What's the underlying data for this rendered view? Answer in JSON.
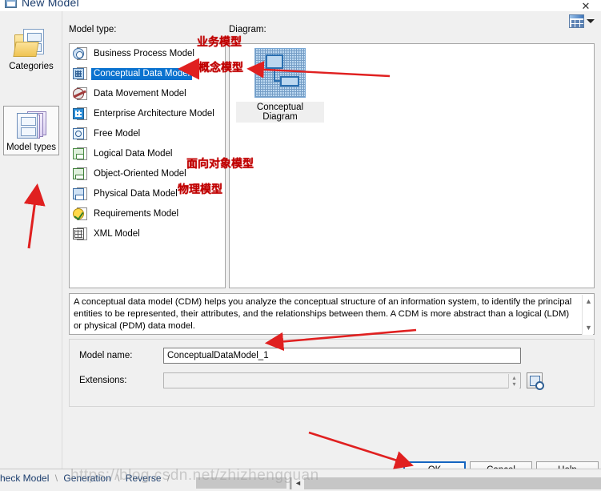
{
  "window": {
    "title": "New Model",
    "close_label": "✕"
  },
  "sidebar": {
    "items": [
      {
        "label": "Categories",
        "icon": "folder-documents-icon",
        "selected": false
      },
      {
        "label": "Model types",
        "icon": "layered-pages-icon",
        "selected": true
      }
    ]
  },
  "labels": {
    "model_type": "Model type:",
    "diagram": "Diagram:"
  },
  "toolbar": {
    "view_mode_icon": "grid-view-icon",
    "view_mode_caret": "chevron-down-icon"
  },
  "model_types": [
    {
      "label": "Business Process Model",
      "icon": "business-process-model-icon",
      "selected": false
    },
    {
      "label": "Conceptual Data Model",
      "icon": "conceptual-data-model-icon",
      "selected": true
    },
    {
      "label": "Data Movement Model",
      "icon": "data-movement-model-icon",
      "selected": false
    },
    {
      "label": "Enterprise Architecture Model",
      "icon": "enterprise-architecture-model-icon",
      "selected": false
    },
    {
      "label": "Free Model",
      "icon": "free-model-icon",
      "selected": false
    },
    {
      "label": "Logical Data Model",
      "icon": "logical-data-model-icon",
      "selected": false
    },
    {
      "label": "Object-Oriented Model",
      "icon": "object-oriented-model-icon",
      "selected": false
    },
    {
      "label": "Physical Data Model",
      "icon": "physical-data-model-icon",
      "selected": false
    },
    {
      "label": "Requirements Model",
      "icon": "requirements-model-icon",
      "selected": false
    },
    {
      "label": "XML Model",
      "icon": "xml-model-icon",
      "selected": false
    }
  ],
  "diagram": {
    "items": [
      {
        "label": "Conceptual Diagram",
        "icon": "conceptual-diagram-thumbnail",
        "selected": true
      }
    ]
  },
  "description": "A conceptual data model (CDM) helps you analyze the conceptual structure of an information system, to identify the principal entities to be represented, their attributes, and the relationships between them. A CDM is more abstract than a logical (LDM) or physical (PDM) data model.",
  "form": {
    "model_name_label": "Model name:",
    "model_name_value": "ConceptualDataModel_1",
    "extensions_label": "Extensions:",
    "extensions_value": "",
    "extensions_button_icon": "extensions-browse-icon"
  },
  "buttons": {
    "ok": "OK",
    "cancel": "Cancel",
    "help": "Help"
  },
  "background_tabs": {
    "items": [
      "heck Model",
      "Generation",
      "Reverse"
    ],
    "separator": "\\"
  },
  "annotations": [
    {
      "text": "业务模型",
      "note": "business model - points at Business Process Model"
    },
    {
      "text": "概念模型",
      "note": "conceptual model - points at Conceptual Data Model"
    },
    {
      "text": "面向对象模型",
      "note": "object-oriented model"
    },
    {
      "text": "物理模型",
      "note": "physical model"
    }
  ],
  "watermark": "https://blog.csdn.net/zhizhengguan",
  "colors": {
    "selection_blue": "#0a72cf",
    "annotation_red": "#c00000",
    "default_button_border": "#1565c0",
    "dialog_background": "#f0f0f0"
  }
}
